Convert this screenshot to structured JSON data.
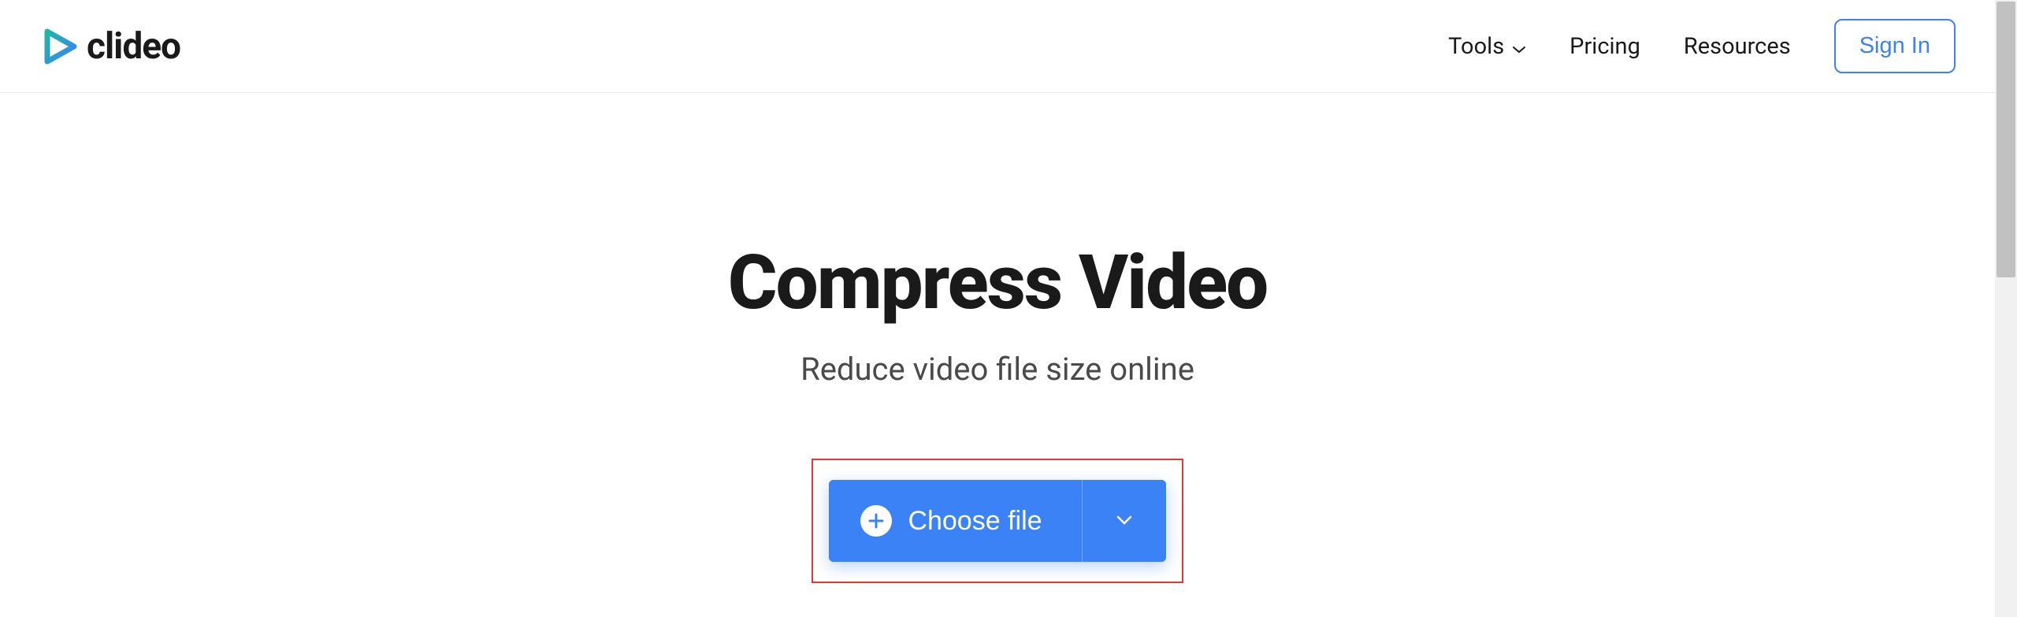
{
  "header": {
    "logo_text": "clideo",
    "nav": {
      "tools": "Tools",
      "pricing": "Pricing",
      "resources": "Resources",
      "sign_in": "Sign In"
    }
  },
  "main": {
    "title": "Compress Video",
    "subtitle": "Reduce video file size online",
    "choose_file_label": "Choose file"
  }
}
